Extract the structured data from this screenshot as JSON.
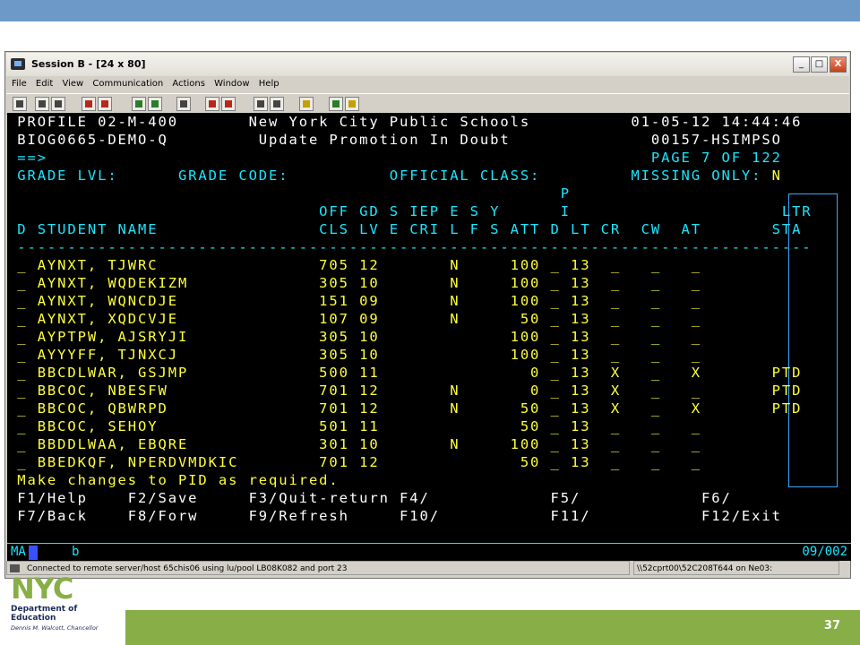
{
  "colors": {
    "top_band": "#6c99c8",
    "footer_band": "#88ae48",
    "terminal_bg": "#000000"
  },
  "window": {
    "title": "Session B - [24 x 80]",
    "buttons": {
      "minimize": "_",
      "maximize": "□",
      "close": "X"
    }
  },
  "menu": [
    "File",
    "Edit",
    "View",
    "Communication",
    "Actions",
    "Window",
    "Help"
  ],
  "toolbar_icons": [
    "print-icon",
    "copy-icon",
    "paste-icon",
    "send-icon",
    "receive-icon",
    "display-icon",
    "keypad-icon",
    "record-icon",
    "play-icon",
    "pause-icon",
    "macro-icon",
    "stop-icon",
    "clipboard-icon",
    "globe-icon",
    "settings-icon"
  ],
  "terminal": {
    "lines": [
      {
        "text": " PROFILE 02-M-400       New York City Public Schools          01-05-12 14:44:46",
        "color": "w"
      },
      {
        "text": " BIOG0665-DEMO-Q         Update Promotion In Doubt              00157-HSIMPSO",
        "color": "w"
      },
      {
        "text": " ==>                                                            PAGE 7 OF 122",
        "color": "c"
      },
      {
        "text": " GRADE LVL:      GRADE CODE:          OFFICIAL CLASS:         MISSING ONLY: ",
        "color": "c"
      },
      {
        "text": "                                                       P",
        "color": "c"
      },
      {
        "text": "                               OFF GD S IEP E S Y      I                     LTR",
        "color": "c"
      },
      {
        "text": " D STUDENT NAME                CLS LV E CRI L F S ATT D LT CR  CW  AT       STA",
        "color": "c"
      },
      {
        "text": " -------------------------------------------------------------------------------",
        "color": "c"
      },
      {
        "text": " _ AYNXT, TJWRC                705 12       N     100 _ 13  _   _   _",
        "color": "y"
      },
      {
        "text": " _ AYNXT, WQDEKIZM             305 10       N     100 _ 13  _   _   _",
        "color": "y"
      },
      {
        "text": " _ AYNXT, WQNCDJE              151 09       N     100 _ 13  _   _   _",
        "color": "y"
      },
      {
        "text": " _ AYNXT, XQDCVJE              107 09       N      50 _ 13  _   _   _",
        "color": "y"
      },
      {
        "text": " _ AYPTPW, AJSRYJI             305 10             100 _ 13  _   _   _",
        "color": "y"
      },
      {
        "text": " _ AYYYFF, TJNXCJ              305 10             100 _ 13  _   _   _",
        "color": "y"
      },
      {
        "text": " _ BBCDLWAR, GSJMP             500 11               0 _ 13  X   _   X       PTD",
        "color": "y"
      },
      {
        "text": " _ BBCOC, NBESFW               701 12       N       0 _ 13  X   _   _       PTD",
        "color": "y"
      },
      {
        "text": " _ BBCOC, QBWRPD               701 12       N      50 _ 13  X   _   X       PTD",
        "color": "y"
      },
      {
        "text": " _ BBCOC, SEHOY                501 11              50 _ 13  _   _   _",
        "color": "y"
      },
      {
        "text": " _ BBDDLWAA, EBQRE             301 10       N     100 _ 13  _   _   _",
        "color": "y"
      },
      {
        "text": " _ BBEDKQF, NPERDVMDKIC        701 12              50 _ 13  _   _   _",
        "color": "y"
      },
      {
        "text": " Make changes to PID as required.",
        "color": "y"
      },
      {
        "text": " F1/Help    F2/Save     F3/Quit-return F4/            F5/            F6/",
        "color": "w"
      },
      {
        "text": " F7/Back    F8/Forw     F9/Refresh     F10/           F11/           F12/Exit",
        "color": "w"
      }
    ],
    "missing_only_value": "N",
    "oia": {
      "indicator": "MA",
      "session": "b",
      "position": "09/002"
    }
  },
  "status": {
    "connection": "Connected to remote server/host 65chis06 using lu/pool LB08K082 and port 23",
    "printer": "\\\\52cprt00\\52C208T644 on Ne03:"
  },
  "slide": {
    "logo_nyc": "NYC",
    "logo_line1": "Department of",
    "logo_line2": "Education",
    "logo_line3": "Dennis M. Walcott, Chancellor",
    "page_number": "37"
  }
}
